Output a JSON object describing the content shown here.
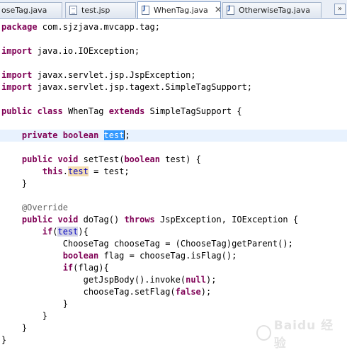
{
  "tabs": [
    {
      "label": "oseTag.java",
      "icon": "java-file-icon"
    },
    {
      "label": "test.jsp",
      "icon": "jsp-file-icon"
    },
    {
      "label": "WhenTag.java",
      "icon": "java-file-icon",
      "active": true,
      "close": "✕"
    },
    {
      "label": "OtherwiseTag.java",
      "icon": "java-file-icon"
    }
  ],
  "scroll_glyph": "»",
  "code": [
    "package com.sjzjava.mvcapp.tag;",
    "",
    "import java.io.IOException;",
    "",
    "import javax.servlet.jsp.JspException;",
    "import javax.servlet.jsp.tagext.SimpleTagSupport;",
    "",
    "public class WhenTag extends SimpleTagSupport {",
    "",
    "    private boolean test;",
    "",
    "    public void setTest(boolean test) {",
    "        this.test = test;",
    "    }",
    "",
    "    @Override",
    "    public void doTag() throws JspException, IOException {",
    "        if(test){",
    "            ChooseTag chooseTag = (ChooseTag)getParent();",
    "            boolean flag = chooseTag.isFlag();",
    "            if(flag){",
    "                getJspBody().invoke(null);",
    "                chooseTag.setFlag(false);",
    "            }",
    "        }",
    "    }",
    "}"
  ],
  "current_line_index": 9,
  "colors": {
    "keyword": "#7f0055",
    "field": "#0000c0",
    "annotation": "#646464",
    "selection": "#3399ff",
    "current_line": "#e8f2fe"
  },
  "watermark": "Baidu 经验"
}
